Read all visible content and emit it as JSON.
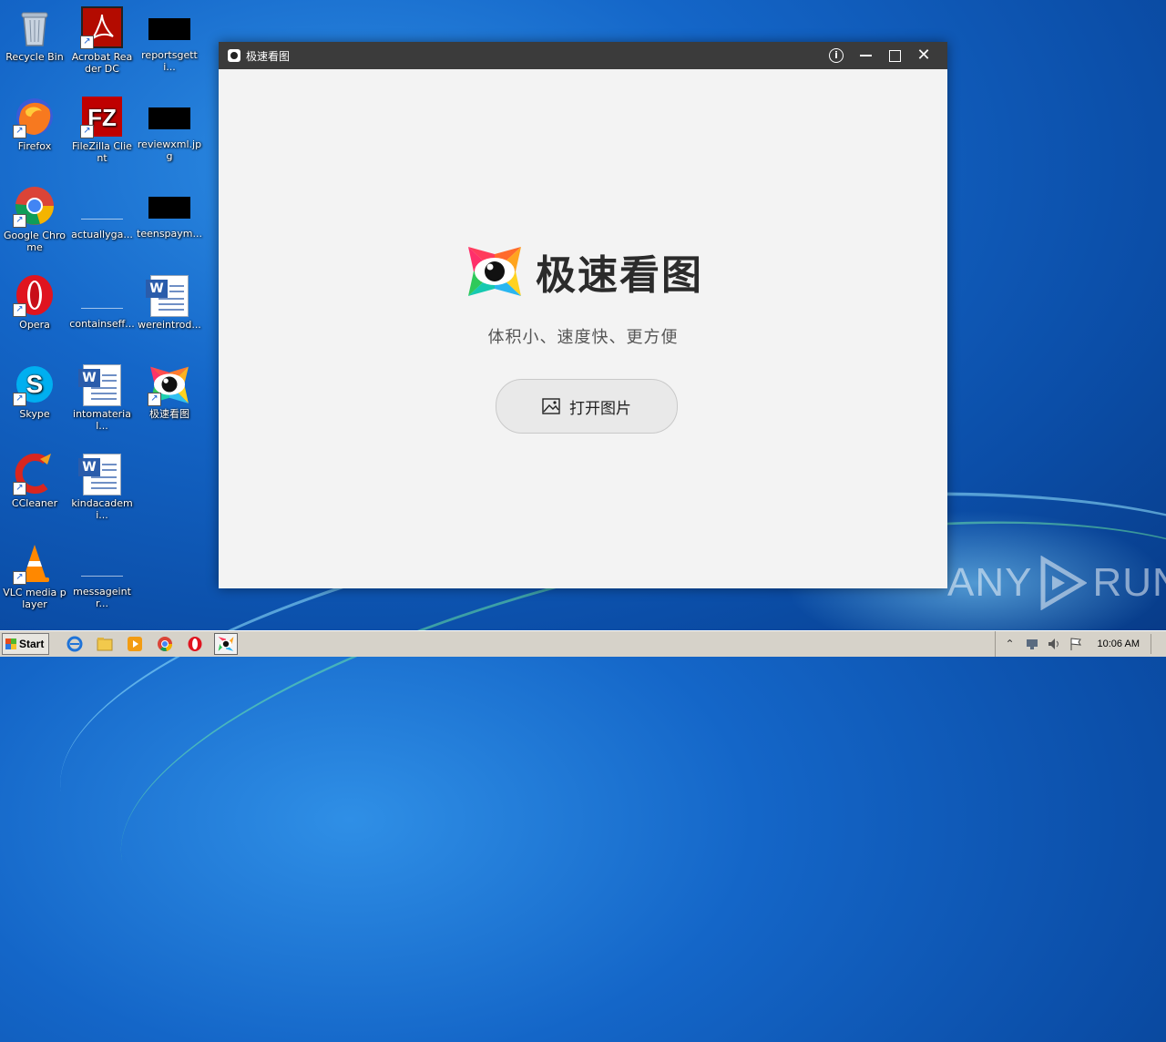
{
  "desktop": {
    "icons": [
      {
        "label": "Recycle Bin"
      },
      {
        "label": "Acrobat Reader DC"
      },
      {
        "label": "reportsgetti..."
      },
      {
        "label": "Firefox"
      },
      {
        "label": "FileZilla Client"
      },
      {
        "label": "reviewxml.jpg"
      },
      {
        "label": "Google Chrome"
      },
      {
        "label": "actuallyga..."
      },
      {
        "label": "teenspaym..."
      },
      {
        "label": "Opera"
      },
      {
        "label": "containseff..."
      },
      {
        "label": "wereintrod..."
      },
      {
        "label": "Skype"
      },
      {
        "label": "intomaterial..."
      },
      {
        "label": "极速看图"
      },
      {
        "label": "CCleaner"
      },
      {
        "label": "kindacademi..."
      },
      {
        "label": "VLC media player"
      },
      {
        "label": "messageintr..."
      }
    ]
  },
  "window": {
    "title": "极速看图",
    "brand_name": "极速看图",
    "tagline": "体积小、速度快、更方便",
    "open_button_label": "打开图片"
  },
  "watermark": {
    "left": "ANY",
    "right": "RUN"
  },
  "taskbar": {
    "start_label": "Start",
    "clock": "10:06 AM"
  },
  "colors": {
    "title_bar": "#3b3b3b",
    "window_bg": "#f3f3f3",
    "desktop_blue": "#1466c8"
  }
}
